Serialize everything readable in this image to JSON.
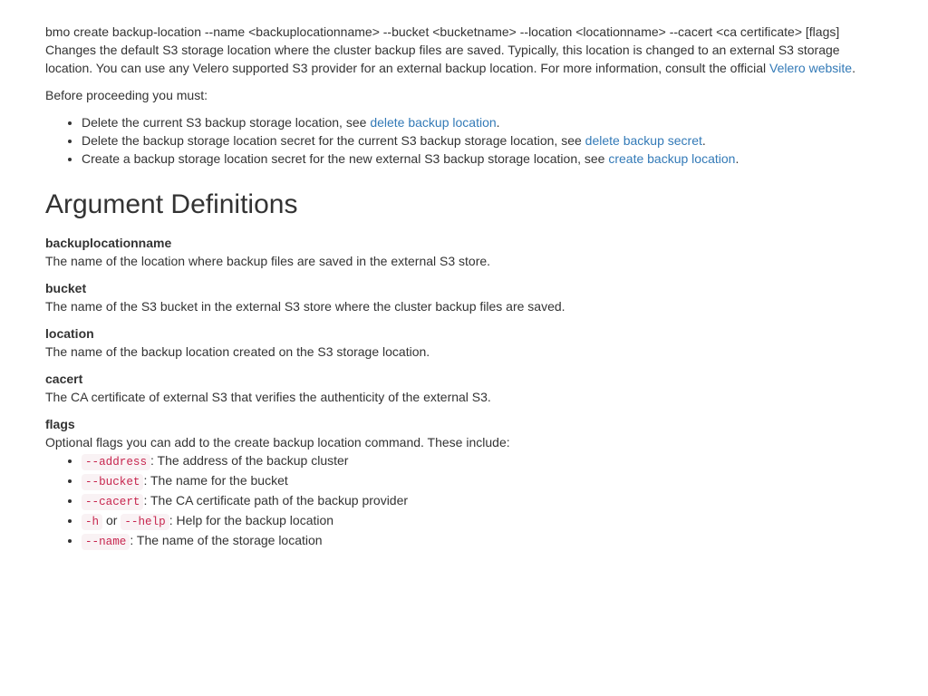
{
  "synopsis": "bmo create backup-location --name <backuplocationname> --bucket <bucketname> --location <locationname> --cacert <ca certificate> [flags]",
  "desc_main": "Changes the default S3 storage location where the cluster backup files are saved. Typically, this location is changed to an external S3 storage location. You can use any Velero supported S3 provider for an external backup location. For more information, consult the official ",
  "velero_link": "Velero website",
  "period": ".",
  "before_proceed": "Before proceeding you must:",
  "prereqs": [
    {
      "text": "Delete the current S3 backup storage location, see ",
      "link": "delete backup location"
    },
    {
      "text": "Delete the backup storage location secret for the current S3 backup storage location, see ",
      "link": "delete backup secret"
    },
    {
      "text": "Create a backup storage location secret for the new external S3 backup storage location, see ",
      "link": "create backup location"
    }
  ],
  "heading_args": "Argument Definitions",
  "args": {
    "backuplocationname": {
      "term": "backuplocationname",
      "def": "The name of the location where backup files are saved in the external S3 store."
    },
    "bucket": {
      "term": "bucket",
      "def": "The name of the S3 bucket in the external S3 store where the cluster backup files are saved."
    },
    "location": {
      "term": "location",
      "def": "The name of the backup location created on the S3 storage location."
    },
    "cacert": {
      "term": "cacert",
      "def": "The CA certificate of external S3 that verifies the authenticity of the external S3."
    },
    "flags": {
      "term": "flags",
      "intro": "Optional flags you can add to the create backup location command. These include:"
    }
  },
  "flag_list": {
    "address": {
      "code": "--address",
      "text": ": The address of the backup cluster"
    },
    "bucket": {
      "code": "--bucket",
      "text": ": The name for the bucket"
    },
    "cacert": {
      "code": "--cacert",
      "text": ": The CA certificate path of the backup provider"
    },
    "help": {
      "code1": "-h",
      "or": " or ",
      "code2": "--help",
      "text": ": Help for the backup location"
    },
    "name": {
      "code": "--name",
      "text": ": The name of the storage location"
    }
  }
}
